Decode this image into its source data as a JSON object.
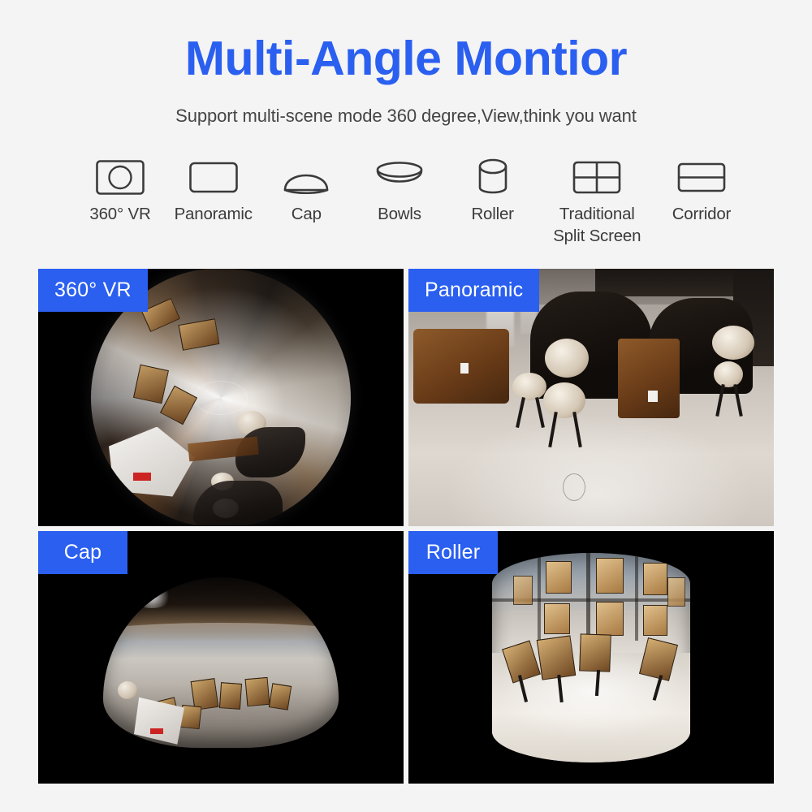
{
  "header": {
    "title": "Multi-Angle Montior",
    "subtitle": "Support multi-scene mode 360 degree,View,think you want",
    "title_color": "#2a5ff0",
    "subtitle_color": "#454545"
  },
  "modes": [
    {
      "label": "360° VR",
      "icon": "rect-with-circle-icon"
    },
    {
      "label": "Panoramic",
      "icon": "rounded-rect-icon"
    },
    {
      "label": "Cap",
      "icon": "dome-icon"
    },
    {
      "label": "Bowls",
      "icon": "bowl-icon"
    },
    {
      "label": "Roller",
      "icon": "cylinder-icon"
    },
    {
      "label": "Traditional\nSplit Screen",
      "icon": "quad-grid-icon"
    },
    {
      "label": "Corridor",
      "icon": "split-rect-icon"
    }
  ],
  "panels": [
    {
      "badge": "360° VR",
      "scene": "fisheye-cafe-interior"
    },
    {
      "badge": "Panoramic",
      "scene": "dewarped-cafe-booths"
    },
    {
      "badge": "Cap",
      "scene": "dome-projection-cafe"
    },
    {
      "badge": "Roller",
      "scene": "cylinder-projection-cafe"
    }
  ],
  "theme": {
    "page_background": "#f4f4f4",
    "badge_background": "#2a5ff0",
    "badge_text": "#ffffff",
    "panel_background": "#000000",
    "icon_stroke": "#3b3b3b"
  }
}
